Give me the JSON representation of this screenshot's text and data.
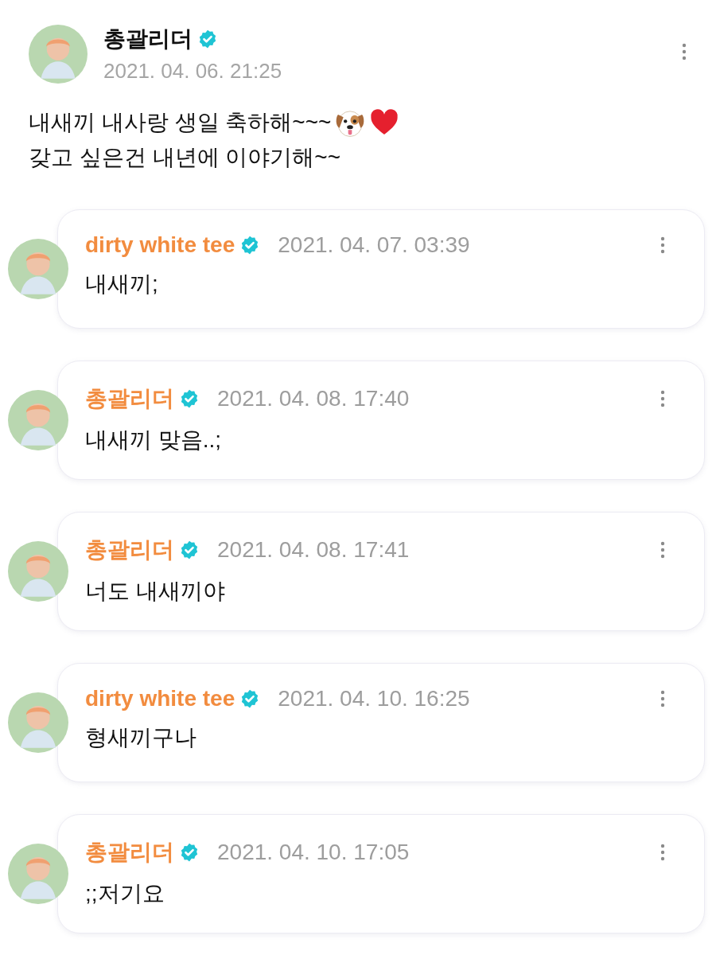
{
  "post": {
    "author": "총괄리더",
    "verified": true,
    "time": "2021. 04. 06. 21:25",
    "lines": [
      "내새끼 내사랑 생일 축하해~~~",
      "갖고 싶은건 내년에 이야기해~~"
    ]
  },
  "comments": [
    {
      "author": "dirty white tee",
      "verified": true,
      "time": "2021. 04. 07. 03:39",
      "text": "내새끼;"
    },
    {
      "author": "총괄리더",
      "verified": true,
      "time": "2021. 04. 08. 17:40",
      "text": "내새끼 맞음..;"
    },
    {
      "author": "총괄리더",
      "verified": true,
      "time": "2021. 04. 08. 17:41",
      "text": "너도 내새끼야"
    },
    {
      "author": "dirty white tee",
      "verified": true,
      "time": "2021. 04. 10. 16:25",
      "text": "형새끼구나"
    },
    {
      "author": "총괄리더",
      "verified": true,
      "time": "2021. 04. 10. 17:05",
      "text": ";;저기요"
    }
  ]
}
